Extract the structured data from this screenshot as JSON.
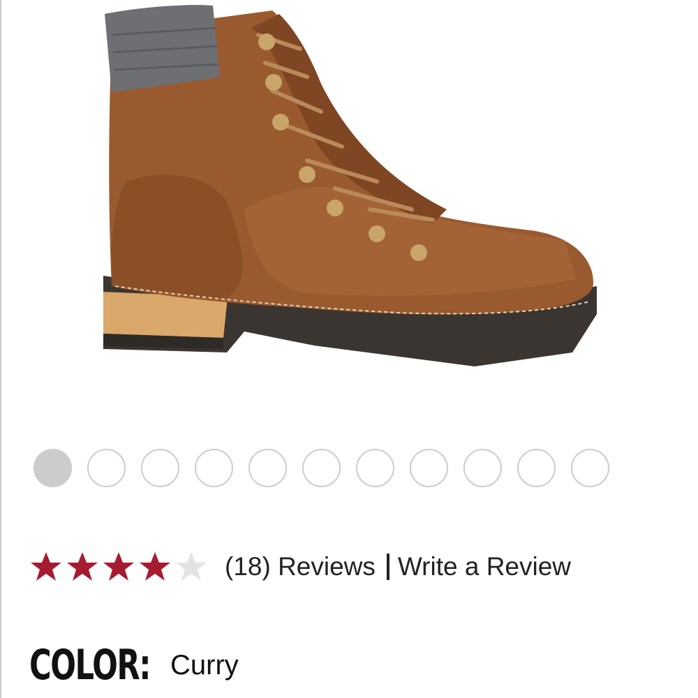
{
  "product": {
    "image_icon": "hiking-boot-photo"
  },
  "carousel": {
    "total": 11,
    "active_index": 0,
    "active_color": "#cccccc",
    "inactive_border": "#cccccc"
  },
  "rating": {
    "value": 4,
    "max": 5,
    "filled_color": "#a51c30",
    "empty_color": "#e3e3e3",
    "reviews_label": "(18) Reviews",
    "write_review_label": "Write a Review"
  },
  "color": {
    "label": "COLOR:",
    "value": "Curry"
  }
}
